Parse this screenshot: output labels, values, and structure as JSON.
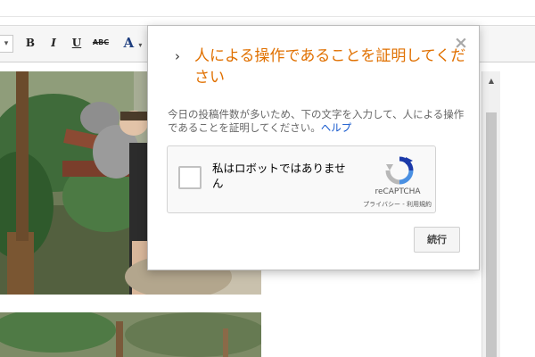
{
  "toolbar": {
    "dropdown_icon": "chevron-down-icon",
    "bold_label": "B",
    "italic_label": "I",
    "underline_label": "U",
    "strike_label": "ABC",
    "text_color_label": "A",
    "text_color_arrow": "▾"
  },
  "dialog": {
    "chevron": "›",
    "title": "人による操作であることを証明してください",
    "description": "今日の投稿件数が多いため、下の文字を入力して、人による操作であることを証明してください。",
    "help_link": "ヘルプ",
    "close_icon": "×",
    "captcha": {
      "checkbox_label": "私はロボットではありません",
      "brand": "reCAPTCHA",
      "links": "プライバシー - 利用規約"
    },
    "continue_label": "続行"
  },
  "scrollbar": {
    "up_arrow": "▲"
  },
  "colors": {
    "title": "#e07000",
    "link": "#1155cc",
    "recaptcha_blue": "#4a90e2",
    "recaptcha_gray": "#b8b8b8"
  }
}
